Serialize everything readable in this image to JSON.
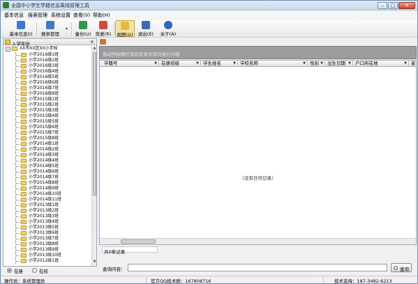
{
  "window": {
    "title": "全国中小学生学籍信息离线管理工具",
    "buttons": {
      "minimize": "–",
      "maximize": "□",
      "close": "✕"
    }
  },
  "menu": [
    "基本信息",
    "报表管理",
    "系统设置",
    "查看(V)",
    "帮助(H)"
  ],
  "toolbar": [
    {
      "label": "基本信息(I)",
      "icon": "document-icon",
      "color": "#3c7bc9"
    },
    {
      "label": "报表管理",
      "icon": "report-edit-icon",
      "color": "#3d79c4"
    },
    {
      "label": "备份(U)",
      "icon": "backup-icon",
      "color": "#2f9a48"
    },
    {
      "label": "恢复(R)",
      "icon": "restore-icon",
      "color": "#d24a3a"
    },
    {
      "label": "视图(G)",
      "icon": "folder-view-icon",
      "color": "#e6b93c"
    },
    {
      "label": "退出(E)",
      "icon": "exit-icon",
      "color": "#3b6bb5"
    },
    {
      "label": "关于(A)",
      "icon": "help-icon",
      "color": "#2a66c2"
    }
  ],
  "left_panel": {
    "title": "入学年份",
    "close": "×",
    "root": "XX市XX区XX小学校",
    "classes": [
      "小学2016级1班",
      "小学2016级2班",
      "小学2016级3班",
      "小学2016级4班",
      "小学2016级5班",
      "小学2016级6班",
      "小学2016级7班",
      "小学2016级8班",
      "小学2015级1班",
      "小学2015级2班",
      "小学2015级3班",
      "小学2015级4班",
      "小学2015级5班",
      "小学2015级6班",
      "小学2015级7班",
      "小学2015级8班",
      "小学2014级1班",
      "小学2014级2班",
      "小学2014级3班",
      "小学2014级4班",
      "小学2014级5班",
      "小学2014级6班",
      "小学2014级7班",
      "小学2014级8班",
      "小学2014级9班",
      "小学2014级10班",
      "小学2014级11班",
      "小学2013级1班",
      "小学2013级2班",
      "小学2013级3班",
      "小学2013级4班",
      "小学2013级5班",
      "小学2013级6班",
      "小学2013级7班",
      "小学2013级8班",
      "小学2013级9班",
      "小学2013级10班",
      "小学2012级1班"
    ],
    "radios": [
      {
        "label": "在册",
        "checked": true
      },
      {
        "label": "在校",
        "checked": false
      }
    ]
  },
  "main": {
    "group_hint": "拖动列标题栏到此处来对该列进行分组",
    "columns": [
      "学籍号",
      "在册班级",
      "学生姓名",
      "学校名称",
      "性别",
      "出生日期",
      "户口所在地",
      "家"
    ],
    "empty_text": "〈没有任何记录〉",
    "record_count": "共0条记录",
    "query_label": "查询内容：",
    "query_value": "",
    "query_button": "查询"
  },
  "status": {
    "operator": "操作员：系统管理员",
    "qq": "官方QQ技术群：167808716",
    "support": "技术支持：187-3482-6213"
  }
}
